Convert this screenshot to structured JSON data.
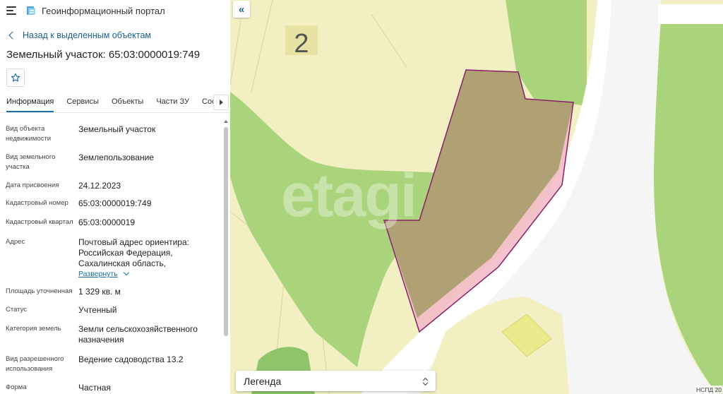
{
  "app": {
    "title": "Геоинформационный портал"
  },
  "navigation": {
    "back_label": "Назад к выделенным объектам"
  },
  "object": {
    "title": "Земельный участок: 65:03:0000019:749"
  },
  "tabs": [
    {
      "label": "Информация",
      "active": true
    },
    {
      "label": "Сервисы",
      "active": false
    },
    {
      "label": "Объекты",
      "active": false
    },
    {
      "label": "Части ЗУ",
      "active": false
    },
    {
      "label": "Состав",
      "active": false
    }
  ],
  "properties": [
    {
      "label": "Вид объекта недвижимости",
      "value": "Земельный участок"
    },
    {
      "label": "Вид земельного участка",
      "value": "Землепользование"
    },
    {
      "label": "Дата присвоения",
      "value": "24.12.2023"
    },
    {
      "label": "Кадастровый номер",
      "value": "65:03:0000019:749"
    },
    {
      "label": "Кадастровый квартал",
      "value": "65:03:0000019"
    },
    {
      "label": "Адрес",
      "value": "Почтовый адрес ориентира: Российская Федерация, Сахалинская область, Корсаковский городской"
    },
    {
      "label": "Площадь уточненная",
      "value": "1 329 кв. м"
    },
    {
      "label": "Статус",
      "value": "Учтенный"
    },
    {
      "label": "Категория земель",
      "value": "Земли сельскохозяйственного назначения"
    },
    {
      "label": "Вид разрешенного использования",
      "value": "Ведение садоводства 13.2"
    },
    {
      "label": "Форма собственности",
      "value": "Частная"
    }
  ],
  "address_expand_label": "Развернуть",
  "map": {
    "block_number": "2",
    "watermark": "etagi",
    "legend_label": "Легенда",
    "attribution": "НСПД 20",
    "colors": {
      "background": "#f2f0c2",
      "forest": "#a9d47b",
      "road": "#ffffff",
      "parcel_fill": "#a89d6c",
      "parcel_stroke": "#8a1f6a"
    }
  },
  "accent_color": "#1a6fa1"
}
